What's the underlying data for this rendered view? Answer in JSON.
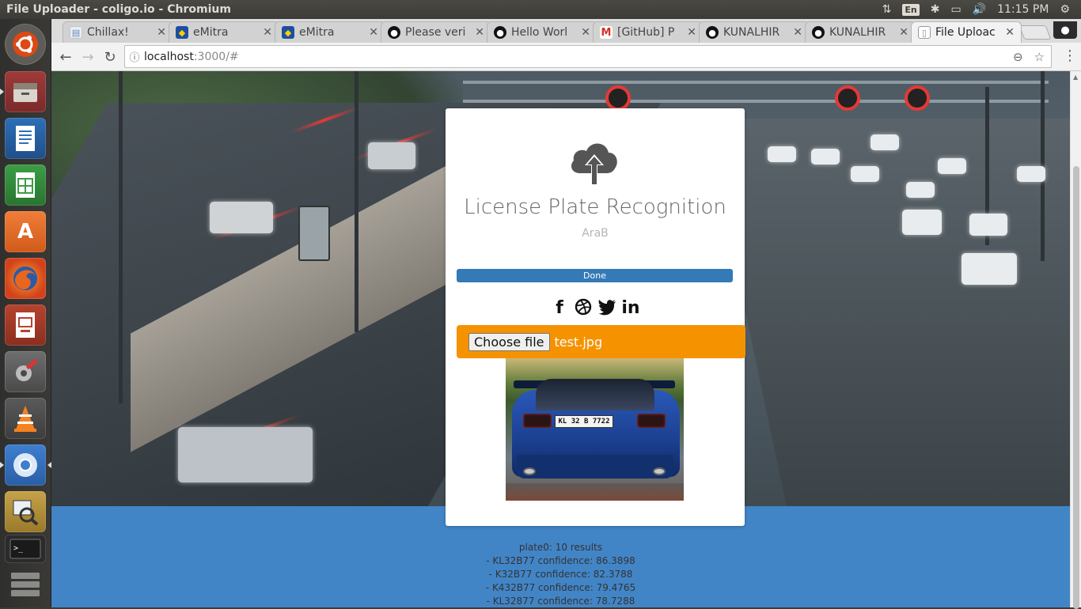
{
  "system": {
    "window_title": "File Uploader - coligo.io - Chromium",
    "lang": "En",
    "time": "11:15 PM",
    "icons": [
      "transfer-icon",
      "bluetooth-icon",
      "battery-icon",
      "volume-icon",
      "power-gear-icon"
    ]
  },
  "launcher": {
    "items": [
      {
        "name": "ubuntu-dash-icon"
      },
      {
        "name": "files-icon"
      },
      {
        "name": "writer-icon"
      },
      {
        "name": "calc-icon"
      },
      {
        "name": "software-center-icon"
      },
      {
        "name": "firefox-icon"
      },
      {
        "name": "impress-icon"
      },
      {
        "name": "settings-icon"
      },
      {
        "name": "vlc-icon"
      },
      {
        "name": "chromium-icon"
      },
      {
        "name": "image-viewer-icon"
      },
      {
        "name": "terminal-icon"
      },
      {
        "name": "workspaces-icon"
      }
    ]
  },
  "browser": {
    "tabs": [
      {
        "label": "Chillax!",
        "icon": "page-icon"
      },
      {
        "label": "eMitra",
        "icon": "emitra-icon"
      },
      {
        "label": "eMitra",
        "icon": "emitra-icon"
      },
      {
        "label": "Please veri",
        "icon": "github-icon"
      },
      {
        "label": "Hello Worl",
        "icon": "github-icon"
      },
      {
        "label": "[GitHub] P",
        "icon": "gmail-icon"
      },
      {
        "label": "KUNALHIR",
        "icon": "github-icon"
      },
      {
        "label": "KUNALHIR",
        "icon": "github-icon"
      },
      {
        "label": "File Uploac",
        "icon": "page-icon"
      }
    ],
    "url_host": "localhost",
    "url_path": ":3000/#"
  },
  "page": {
    "title": "License Plate Recognition",
    "subtitle": "AraB",
    "progress_label": "Done",
    "progress": 1.0,
    "socials": [
      "facebook-icon",
      "dribbble-icon",
      "twitter-icon",
      "linkedin-icon"
    ],
    "file_button": "Choose file",
    "file_name": "test.jpg",
    "plate_text": "KL 32 B 7722",
    "results": [
      "plate0: 10 results",
      "- KL32B77 confidence: 86.3898",
      "- K32B77 confidence: 82.3788",
      "- K432B77 confidence: 79.4765",
      "- KL32877 confidence: 78.7288"
    ]
  },
  "colors": {
    "accent_orange": "#f59200",
    "progress_blue": "#337ab7",
    "footer_blue": "#4285c7"
  }
}
